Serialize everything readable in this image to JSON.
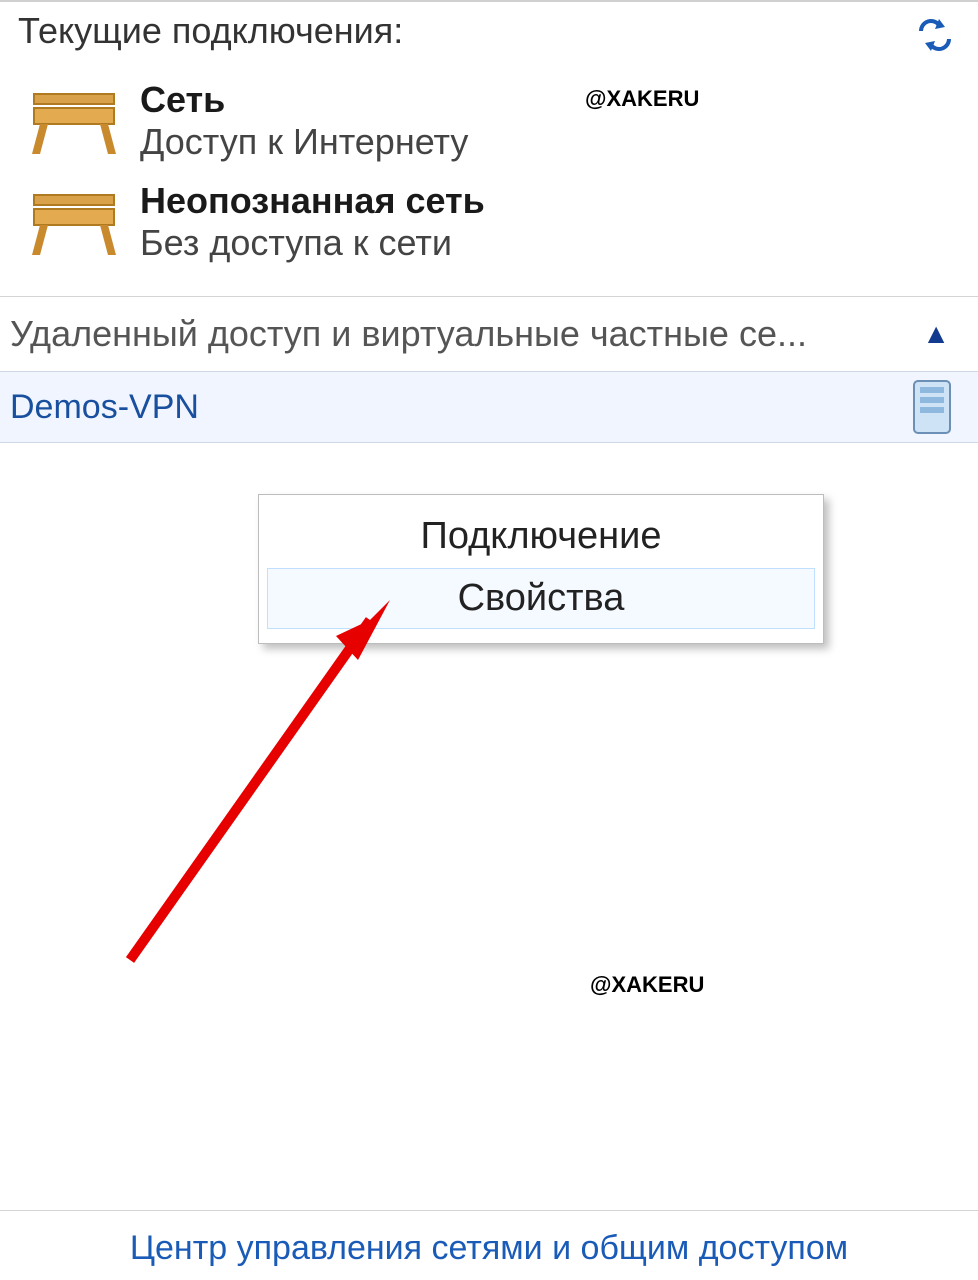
{
  "header": {
    "title": "Текущие подключения:"
  },
  "watermark": "@XAKERU",
  "networks": [
    {
      "name": "Сеть",
      "status": "Доступ к Интернету"
    },
    {
      "name": "Неопознанная сеть",
      "status": "Без доступа к сети"
    }
  ],
  "section": {
    "title": "Удаленный доступ и виртуальные частные се...",
    "chevron": "▲"
  },
  "vpn": {
    "name": "Demos-VPN"
  },
  "context_menu": {
    "items": [
      {
        "label": "Подключение",
        "highlight": false
      },
      {
        "label": "Свойства",
        "highlight": true
      }
    ]
  },
  "footer": {
    "link": "Центр управления сетями и общим доступом"
  }
}
